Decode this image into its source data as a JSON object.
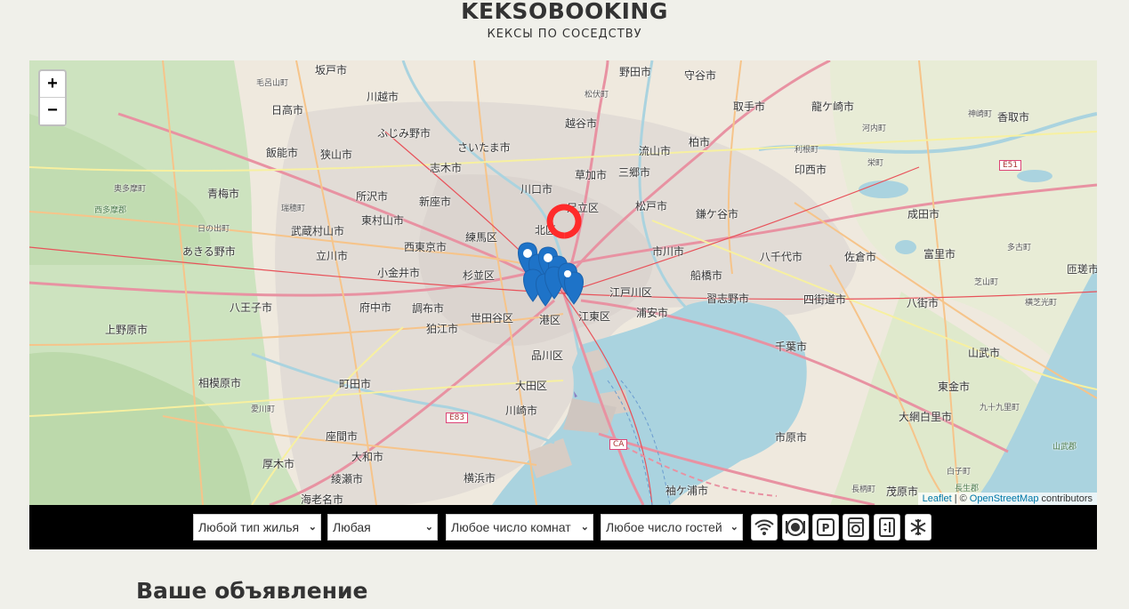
{
  "header": {
    "logo": "KEKSOBOOKING",
    "tagline": "КЕКСЫ ПО СОСЕДСТВУ"
  },
  "map": {
    "zoom_in": "+",
    "zoom_out": "−",
    "attribution": {
      "leaflet": "Leaflet",
      "separator": "| ©",
      "osm": "OpenStreetMap",
      "contributors": "contributors"
    },
    "labels": {
      "sakado": "坂戸市",
      "moroyama": "毛呂山町",
      "kawagoe": "川越市",
      "hidaka": "日高市",
      "fujimi": "ふじみ野市",
      "saitama": "さいたま市",
      "hanno": "飯能市",
      "sayama": "狭山市",
      "shiki": "志木市",
      "okutama": "奥多摩町",
      "ome": "青梅市",
      "tokorozawa": "所沢市",
      "niiza": "新座市",
      "mizuho": "瑞穂町",
      "nishitama": "西多摩郡",
      "higashimurayama": "東村山市",
      "hinode": "日の出町",
      "musashimurayama": "武蔵村山市",
      "nishitokyo": "西東京市",
      "akiruno": "あきる野市",
      "tachikawa": "立川市",
      "koganei": "小金井市",
      "hachioji": "八王子市",
      "fuchu": "府中市",
      "chofu": "調布市",
      "uenohara": "上野原市",
      "komae": "狛江市",
      "sagamihara": "相模原市",
      "machida": "町田市",
      "aikawa": "愛川町",
      "zama": "座間市",
      "atsugi": "厚木市",
      "yamato": "大和市",
      "ayase": "綾瀬市",
      "ebina": "海老名市",
      "nodashi": "野田市",
      "moriya": "守谷市",
      "matsubushi": "松伏町",
      "koshigaya": "越谷市",
      "nagareyama": "流山市",
      "kashiwa": "柏市",
      "soka": "草加市",
      "misato": "三郷市",
      "kawaguchi": "川口市",
      "adachi": "足立区",
      "matsudo": "松戸市",
      "kamagaya": "鎌ケ谷市",
      "kita": "北区",
      "nerima": "練馬区",
      "suginami": "杉並区",
      "ichikawa": "市川市",
      "funabashi": "船橋市",
      "edogawa": "江戸川区",
      "narashino": "習志野市",
      "setagaya": "世田谷区",
      "minato": "港区",
      "koto": "江東区",
      "urayasu": "浦安市",
      "shinagawa": "品川区",
      "ota": "大田区",
      "kawasaki": "川崎市",
      "yokohama": "横浜市",
      "toride": "取手市",
      "ryugasaki": "龍ケ崎市",
      "tone": "利根町",
      "kawachi": "河内町",
      "inzai": "印西市",
      "sakae": "栄町",
      "kozaki": "神崎町",
      "katori": "香取市",
      "narita": "成田市",
      "yachiyo": "八千代市",
      "sakura": "佐倉市",
      "tomisato": "富里市",
      "tako": "多古町",
      "yotsukaido": "四街道市",
      "yachimata": "八街市",
      "shibayama": "芝山町",
      "sosa": "匝瑳市",
      "yokoshiba": "横芝光町",
      "chiba": "千葉市",
      "sanmu": "山武市",
      "togane": "東金市",
      "oamishirasato": "大網白里市",
      "kujukuri": "九十九里町",
      "ichihara": "市原市",
      "sodegaura": "袖ケ浦市",
      "nagara": "長柄町",
      "mobara": "茂原市",
      "shirako": "白子町",
      "sanbu": "山武郡",
      "chosei": "長生郡",
      "e51": "E51",
      "e83": "E83",
      "ca": "CA"
    }
  },
  "filters": {
    "housing_type": "Любой тип жилья",
    "price": "Любая",
    "rooms": "Любое число комнат",
    "guests": "Любое число гостей",
    "features": [
      "wifi-icon",
      "dishwasher-icon",
      "parking-icon",
      "washer-icon",
      "elevator-icon",
      "conditioner-icon"
    ]
  },
  "ad_form": {
    "title": "Ваше объявление"
  },
  "colors": {
    "background": "#f0f0ea",
    "pin_blue": "#1e73c8",
    "pin_red": "#ff2a2a",
    "sea": "#aad3df",
    "filter_bar": "#000000"
  }
}
